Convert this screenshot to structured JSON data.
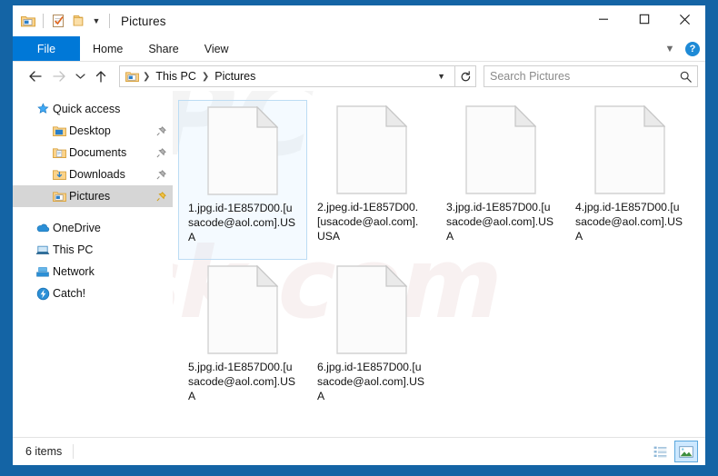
{
  "window": {
    "title": "Pictures",
    "quick_access_toolbar": [
      {
        "name": "folder-properties-icon",
        "label": "Pictures"
      },
      {
        "name": "properties-icon",
        "label": "Properties"
      },
      {
        "name": "new-folder-icon",
        "label": "New folder"
      },
      {
        "name": "chevron-down-icon",
        "label": "Customize Quick Access Toolbar"
      }
    ],
    "controls": {
      "minimize": "Minimize",
      "maximize": "Maximize",
      "close": "Close"
    }
  },
  "ribbon": {
    "tabs": [
      {
        "label": "File",
        "active": true
      },
      {
        "label": "Home",
        "active": false
      },
      {
        "label": "Share",
        "active": false
      },
      {
        "label": "View",
        "active": false
      }
    ],
    "collapse_label": "Minimize the Ribbon",
    "help_label": "?"
  },
  "address_bar": {
    "back": "Back",
    "forward": "Forward",
    "recent": "Recent locations",
    "up": "Up",
    "breadcrumbs": [
      {
        "label": "This PC"
      },
      {
        "label": "Pictures"
      }
    ],
    "dropdown": "Previous locations",
    "refresh": "Refresh",
    "search_placeholder": "Search Pictures",
    "search_value": ""
  },
  "sidebar": {
    "items": [
      {
        "label": "Quick access",
        "icon": "star-pin-icon",
        "indent": 0,
        "pinned": false,
        "selected": false
      },
      {
        "label": "Desktop",
        "icon": "folder-desktop-icon",
        "indent": 1,
        "pinned": true,
        "selected": false
      },
      {
        "label": "Documents",
        "icon": "folder-documents-icon",
        "indent": 1,
        "pinned": true,
        "selected": false
      },
      {
        "label": "Downloads",
        "icon": "folder-downloads-icon",
        "indent": 1,
        "pinned": true,
        "selected": false
      },
      {
        "label": "Pictures",
        "icon": "folder-pictures-icon",
        "indent": 1,
        "pinned": true,
        "selected": true
      },
      {
        "label": "OneDrive",
        "icon": "onedrive-cloud-icon",
        "indent": 0,
        "pinned": false,
        "selected": false
      },
      {
        "label": "This PC",
        "icon": "this-pc-icon",
        "indent": 0,
        "pinned": false,
        "selected": false
      },
      {
        "label": "Network",
        "icon": "network-icon",
        "indent": 0,
        "pinned": false,
        "selected": false
      },
      {
        "label": "Catch!",
        "icon": "catch-icon",
        "indent": 0,
        "pinned": false,
        "selected": false
      }
    ]
  },
  "files": [
    {
      "name": "1.jpg.id-1E857D00.[usacode@aol.com].USA",
      "selected": true
    },
    {
      "name": "2.jpeg.id-1E857D00.[usacode@aol.com].USA",
      "selected": false
    },
    {
      "name": "3.jpg.id-1E857D00.[usacode@aol.com].USA",
      "selected": false
    },
    {
      "name": "4.jpg.id-1E857D00.[usacode@aol.com].USA",
      "selected": false
    },
    {
      "name": "5.jpg.id-1E857D00.[usacode@aol.com].USA",
      "selected": false
    },
    {
      "name": "6.jpg.id-1E857D00.[usacode@aol.com].USA",
      "selected": false
    }
  ],
  "watermark": {
    "text_top": "PC",
    "text_main": "risk.com"
  },
  "status_bar": {
    "item_count": "6 items",
    "views": [
      {
        "name": "details-view-icon",
        "label": "Details view",
        "active": false
      },
      {
        "name": "large-icons-view-icon",
        "label": "Large icons view",
        "active": true
      }
    ]
  },
  "colors": {
    "accent": "#0078d7",
    "desktop": "#1464a5",
    "selection": "#cde8ff"
  }
}
